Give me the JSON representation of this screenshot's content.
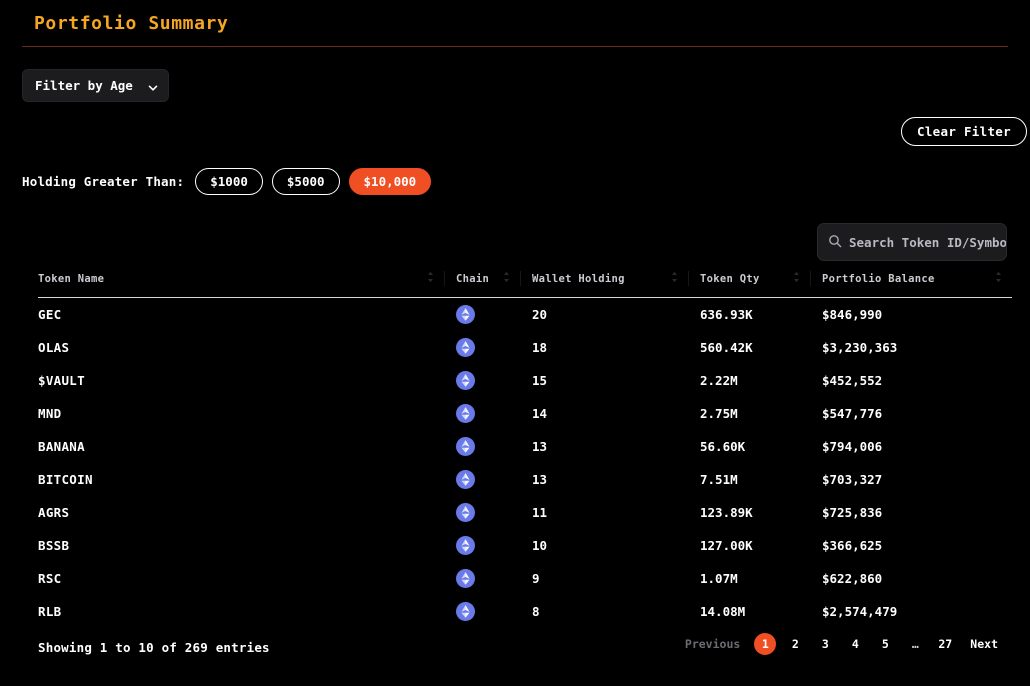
{
  "header": {
    "title": "Portfolio Summary"
  },
  "filters": {
    "age_select": {
      "label": "Filter by Age",
      "icon": "chevron-down-icon"
    },
    "clear_button": "Clear Filter",
    "holding_label": "Holding Greater Than:",
    "holding_options": [
      {
        "label": "$1000",
        "active": false
      },
      {
        "label": "$5000",
        "active": false
      },
      {
        "label": "$10,000",
        "active": true
      }
    ]
  },
  "search": {
    "placeholder": "Search Token ID/Symbol",
    "value": "",
    "icon": "search-icon"
  },
  "table": {
    "columns": [
      {
        "label": "Token Name",
        "sortable": true
      },
      {
        "label": "Chain",
        "sortable": true
      },
      {
        "label": "Wallet Holding",
        "sortable": true
      },
      {
        "label": "Token Qty",
        "sortable": true
      },
      {
        "label": "Portfolio Balance",
        "sortable": true
      }
    ],
    "chain_icon": "ethereum-icon",
    "rows": [
      {
        "token_name": "GEC",
        "chain": "ethereum",
        "wallet_holding": "20",
        "token_qty": "636.93K",
        "portfolio_balance": "$846,990"
      },
      {
        "token_name": "OLAS",
        "chain": "ethereum",
        "wallet_holding": "18",
        "token_qty": "560.42K",
        "portfolio_balance": "$3,230,363"
      },
      {
        "token_name": "$VAULT",
        "chain": "ethereum",
        "wallet_holding": "15",
        "token_qty": "2.22M",
        "portfolio_balance": "$452,552"
      },
      {
        "token_name": "MND",
        "chain": "ethereum",
        "wallet_holding": "14",
        "token_qty": "2.75M",
        "portfolio_balance": "$547,776"
      },
      {
        "token_name": "BANANA",
        "chain": "ethereum",
        "wallet_holding": "13",
        "token_qty": "56.60K",
        "portfolio_balance": "$794,006"
      },
      {
        "token_name": "BITCOIN",
        "chain": "ethereum",
        "wallet_holding": "13",
        "token_qty": "7.51M",
        "portfolio_balance": "$703,327"
      },
      {
        "token_name": "AGRS",
        "chain": "ethereum",
        "wallet_holding": "11",
        "token_qty": "123.89K",
        "portfolio_balance": "$725,836"
      },
      {
        "token_name": "BSSB",
        "chain": "ethereum",
        "wallet_holding": "10",
        "token_qty": "127.00K",
        "portfolio_balance": "$366,625"
      },
      {
        "token_name": "RSC",
        "chain": "ethereum",
        "wallet_holding": "9",
        "token_qty": "1.07M",
        "portfolio_balance": "$622,860"
      },
      {
        "token_name": "RLB",
        "chain": "ethereum",
        "wallet_holding": "8",
        "token_qty": "14.08M",
        "portfolio_balance": "$2,574,479"
      }
    ]
  },
  "footer": {
    "showing": "Showing 1 to 10 of 269 entries",
    "pagination": [
      {
        "label": "Previous",
        "type": "prev",
        "active": false
      },
      {
        "label": "1",
        "type": "page",
        "active": true
      },
      {
        "label": "2",
        "type": "page",
        "active": false
      },
      {
        "label": "3",
        "type": "page",
        "active": false
      },
      {
        "label": "4",
        "type": "page",
        "active": false
      },
      {
        "label": "5",
        "type": "page",
        "active": false
      },
      {
        "label": "…",
        "type": "ellipsis",
        "active": false
      },
      {
        "label": "27",
        "type": "page",
        "active": false
      },
      {
        "label": "Next",
        "type": "next",
        "active": false
      }
    ]
  },
  "colors": {
    "background": "#000000",
    "accent_orange": "#f04e23",
    "title_amber": "#f5a623",
    "rule": "#6e2a18",
    "panel": "#1c1c1e",
    "ethereum_badge": "#6a7ae8"
  }
}
